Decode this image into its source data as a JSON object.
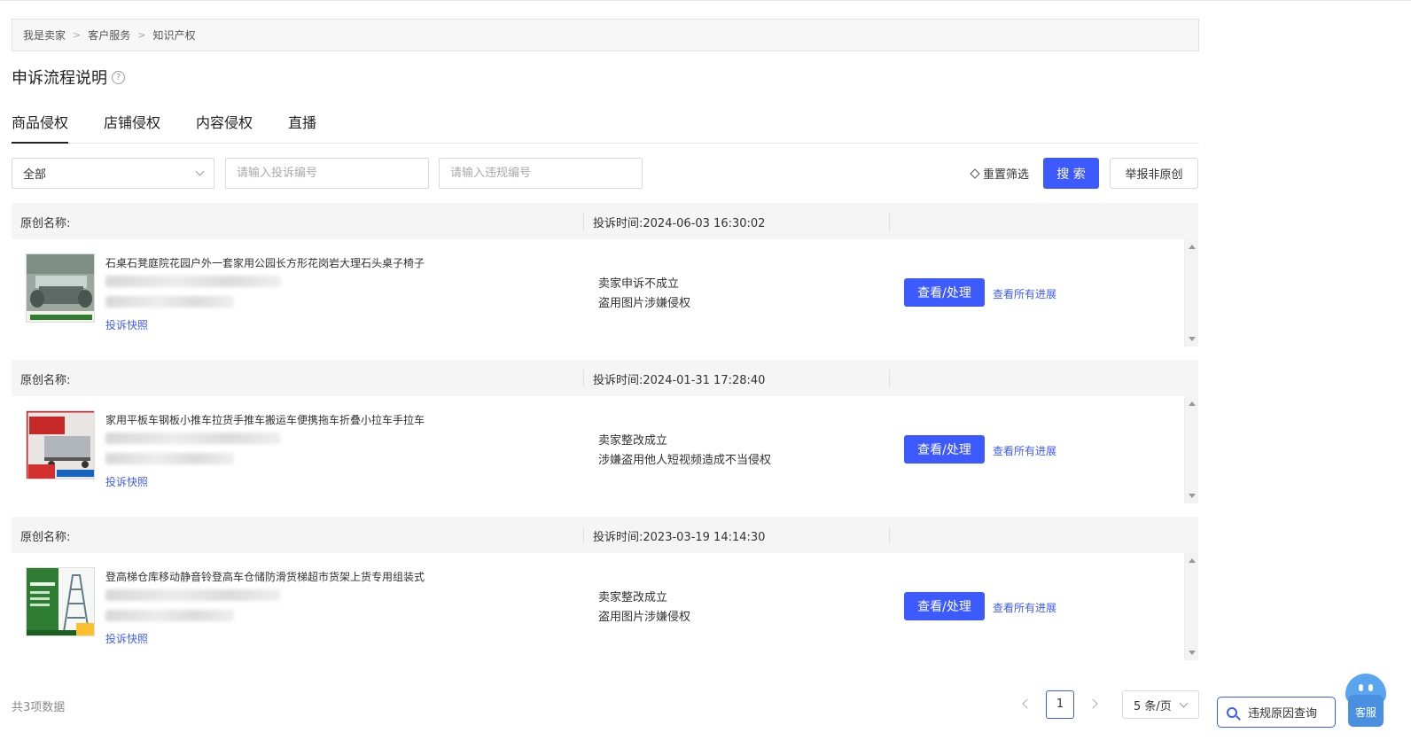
{
  "breadcrumb": [
    "我是卖家",
    "客户服务",
    "知识产权"
  ],
  "breadcrumb_sep": ">",
  "page_title": "申诉流程说明",
  "help_glyph": "?",
  "tabs": [
    {
      "label": "商品侵权",
      "active": true
    },
    {
      "label": "店铺侵权",
      "active": false
    },
    {
      "label": "内容侵权",
      "active": false
    },
    {
      "label": "直播",
      "active": false
    }
  ],
  "filters": {
    "status_value": "全部",
    "complaint_no_placeholder": "请输入投诉编号",
    "violation_no_placeholder": "请输入违规编号",
    "reset_label": "重置筛选",
    "search_label": "搜 索",
    "report_label": "举报非原创"
  },
  "records": [
    {
      "orig_label": "原创名称:",
      "time": "投诉时间:2024-06-03 16:30:02",
      "title": "石桌石凳庭院花园户外一套家用公园长方形花岗岩大理石头桌子椅子",
      "snapshot_label": "投诉快照",
      "status_line1": "卖家申诉不成立",
      "status_line2": "盗用图片涉嫌侵权",
      "action_label": "查看/处理",
      "progress_label": "查看所有进展"
    },
    {
      "orig_label": "原创名称:",
      "time": "投诉时间:2024-01-31 17:28:40",
      "title": "家用平板车钢板小推车拉货手推车搬运车便携拖车折叠小拉车手拉车",
      "snapshot_label": "投诉快照",
      "status_line1": "卖家整改成立",
      "status_line2": "涉嫌盗用他人短视频造成不当侵权",
      "action_label": "查看/处理",
      "progress_label": "查看所有进展"
    },
    {
      "orig_label": "原创名称:",
      "time": "投诉时间:2023-03-19 14:14:30",
      "title": "登高梯仓库移动静音铃登高车仓储防滑货梯超市货架上货专用组装式",
      "snapshot_label": "投诉快照",
      "status_line1": "卖家整改成立",
      "status_line2": "盗用图片涉嫌侵权",
      "action_label": "查看/处理",
      "progress_label": "查看所有进展"
    }
  ],
  "pagination": {
    "total": "共3项数据",
    "current_page": "1",
    "page_size": "5 条/页"
  },
  "floating": {
    "reason_query": "违规原因查询",
    "kefu": "客服"
  },
  "colors": {
    "primary": "#3d5afe",
    "header_bg": "#f5f5f5"
  }
}
